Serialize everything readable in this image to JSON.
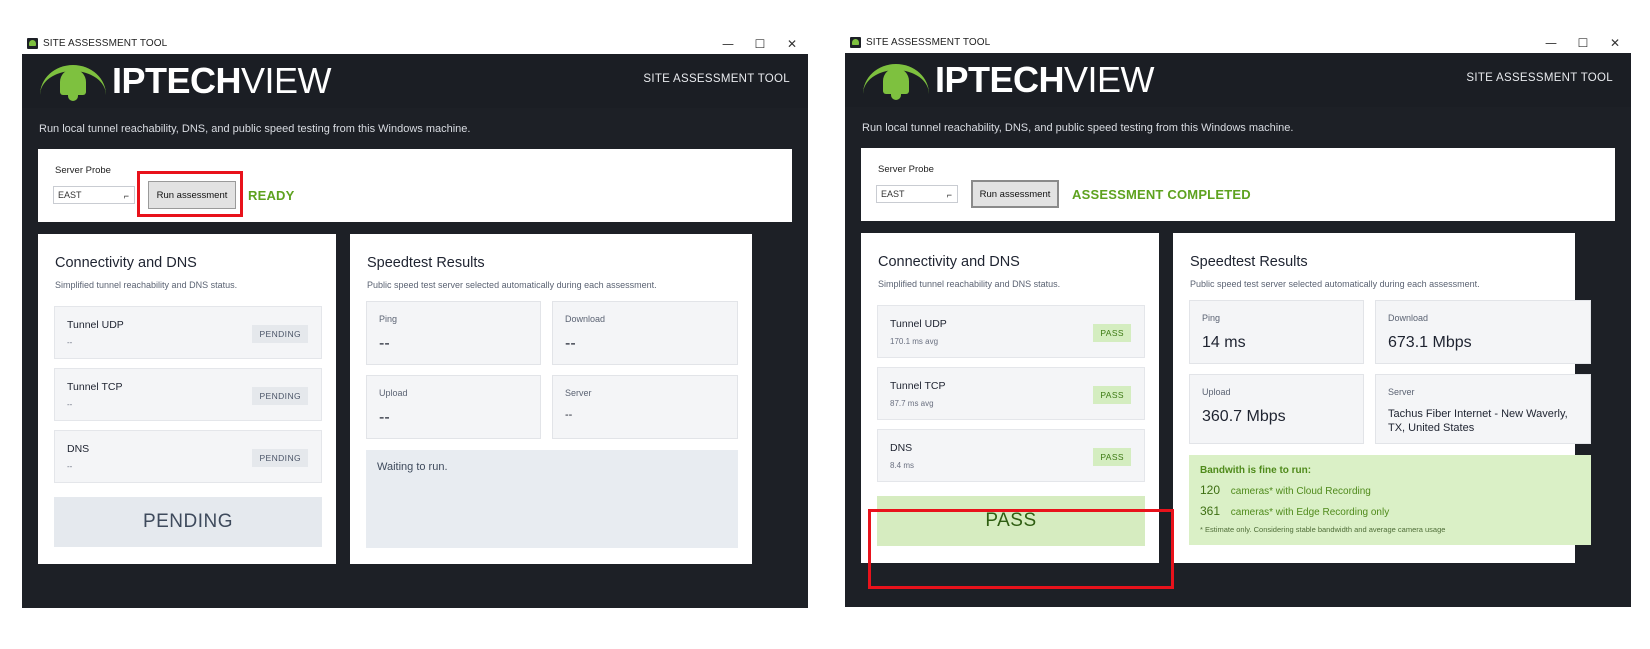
{
  "shared": {
    "window_title": "SITE ASSESSMENT TOOL",
    "brand_bold": "IPTECH",
    "brand_light": "VIEW",
    "header_right": "SITE ASSESSMENT TOOL",
    "subtitle": "Run local tunnel reachability, DNS, and public speed testing from this Windows machine.",
    "probe_label": "Server Probe",
    "probe_value": "EAST",
    "run_button": "Run assessment",
    "conn_title": "Connectivity and DNS",
    "conn_desc": "Simplified tunnel reachability and DNS status.",
    "speed_title": "Speedtest Results",
    "speed_desc": "Public speed test server selected automatically during each assessment.",
    "metric_labels": {
      "ping": "Ping",
      "download": "Download",
      "upload": "Upload",
      "server": "Server"
    },
    "window_controls": {
      "minimize": "—",
      "maximize": "☐",
      "close": "✕"
    }
  },
  "windowA": {
    "status": "READY",
    "rows": [
      {
        "name": "Tunnel UDP",
        "sub": "--",
        "badge": "PENDING"
      },
      {
        "name": "Tunnel TCP",
        "sub": "--",
        "badge": "PENDING"
      },
      {
        "name": "DNS",
        "sub": "--",
        "badge": "PENDING"
      }
    ],
    "verdict": "PENDING",
    "metrics": {
      "ping": "--",
      "download": "--",
      "upload": "--",
      "server": "--"
    },
    "waiting": "Waiting to run."
  },
  "windowB": {
    "status": "ASSESSMENT COMPLETED",
    "rows": [
      {
        "name": "Tunnel UDP",
        "sub": "170.1 ms avg",
        "badge": "PASS"
      },
      {
        "name": "Tunnel TCP",
        "sub": "87.7 ms avg",
        "badge": "PASS"
      },
      {
        "name": "DNS",
        "sub": "8.4 ms",
        "badge": "PASS"
      }
    ],
    "verdict": "PASS",
    "metrics": {
      "ping": "14 ms",
      "download": "673.1 Mbps",
      "upload": "360.7 Mbps",
      "server": "Tachus Fiber Internet - New Waverly, TX, United States"
    },
    "bandwidth": {
      "heading": "Bandwith is fine to run:",
      "cloud_count": "120",
      "cloud_text": "cameras* with Cloud Recording",
      "edge_count": "361",
      "edge_text": "cameras* with Edge Recording only",
      "note": "* Estimate only. Considering stable bandwidth and average camera usage"
    }
  },
  "colors": {
    "accent_green": "#7ec13f",
    "status_green": "#5ea21f",
    "highlight_red": "#e8121b",
    "window_dark": "#1d2026"
  }
}
